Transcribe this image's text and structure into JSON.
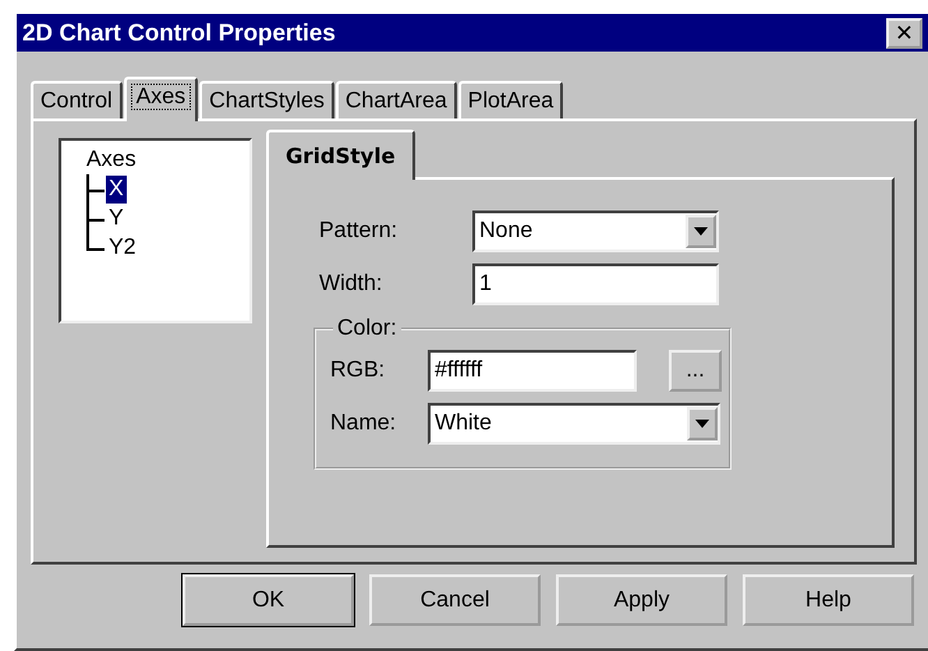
{
  "window": {
    "title": "2D Chart Control Properties",
    "close": "✕"
  },
  "tabs": [
    {
      "label": "Control",
      "selected": false
    },
    {
      "label": "Axes",
      "selected": true
    },
    {
      "label": "ChartStyles",
      "selected": false
    },
    {
      "label": "ChartArea",
      "selected": false
    },
    {
      "label": "PlotArea",
      "selected": false
    }
  ],
  "tree": [
    {
      "label": "Axes",
      "selected": false,
      "children": [
        {
          "label": "X",
          "selected": true
        },
        {
          "label": "Y",
          "selected": false
        },
        {
          "label": "Y2",
          "selected": false
        }
      ]
    }
  ],
  "subtabs": [
    {
      "label": "GridStyle",
      "selected": true
    }
  ],
  "pattern": {
    "label": "Pattern:",
    "value": "None"
  },
  "width": {
    "label": "Width:",
    "value": "1"
  },
  "color_group": {
    "title": "Color:",
    "rgb": {
      "label": "RGB:",
      "value": "#ffffff",
      "button": "..."
    },
    "name": {
      "label": "Name:",
      "value": "White"
    }
  },
  "buttons": [
    {
      "label": "OK",
      "default": true
    },
    {
      "label": "Cancel",
      "default": false
    },
    {
      "label": "Apply",
      "default": false
    },
    {
      "label": "Help",
      "default": false
    }
  ]
}
